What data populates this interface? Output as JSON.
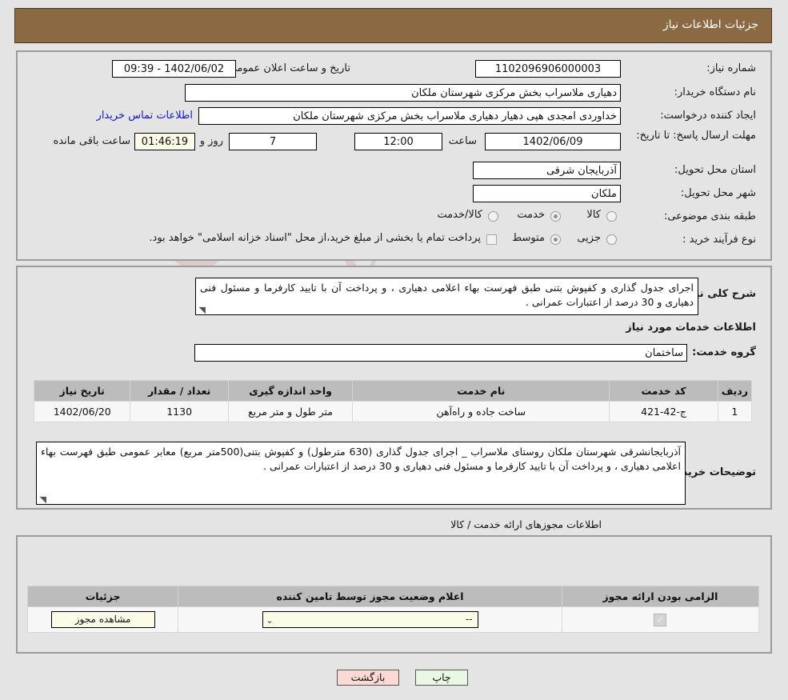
{
  "header": {
    "title": "جزئیات اطلاعات نیاز"
  },
  "top_form": {
    "need_number_label": "شماره نیاز:",
    "need_number_value": "1102096906000003",
    "announce_datetime_label": "تاریخ و ساعت اعلان عمومی:",
    "announce_datetime_value": "1402/06/02 - 09:39",
    "buyer_org_label": "نام دستگاه خریدار:",
    "buyer_org_value": "دهیاری ملاسراب بخش مرکزی شهرستان ملکان",
    "requester_label": "ایجاد کننده درخواست:",
    "requester_value": "خداوردی امجدی هپی دهیار دهیاری ملاسراب بخش مرکزی شهرستان ملکان",
    "contact_link": "اطلاعات تماس خریدار",
    "deadline_label": "مهلت ارسال پاسخ: تا تاریخ:",
    "deadline_date": "1402/06/09",
    "hour_label": "ساعت",
    "hour_value": "12:00",
    "days_value": "7",
    "days_label": "روز و",
    "countdown_value": "01:46:19",
    "remaining_label": "ساعت باقی مانده",
    "province_label": "استان محل تحویل:",
    "province_value": "آذربایجان شرقی",
    "city_label": "شهر محل تحویل:",
    "city_value": "ملکان",
    "classification_label": "طبقه بندی موضوعی:",
    "classification_options": [
      {
        "label": "کالا",
        "selected": false
      },
      {
        "label": "خدمت",
        "selected": true
      },
      {
        "label": "کالا/خدمت",
        "selected": false
      }
    ],
    "process_label": "نوع فرآیند خرید :",
    "process_options": [
      {
        "label": "جزیی",
        "selected": false
      },
      {
        "label": "متوسط",
        "selected": true
      }
    ],
    "treasury_note": "پرداخت تمام یا بخشی از مبلغ خرید،از محل \"اسناد خزانه اسلامی\" خواهد بود."
  },
  "need_summary": {
    "label": "شرح کلی نیاز:",
    "text": "اجرای جدول گذاری و کفپوش بتنی طبق فهرست بهاء اعلامی دهیاری ، و پرداخت آن با تایید کارفرما و مسئول فنی دهیاری و 30 درصد از اعتبارات عمرانی ."
  },
  "services_section": {
    "heading": "اطلاعات خدمات مورد نیاز",
    "service_group_label": "گروه خدمت:",
    "service_group_value": "ساختمان",
    "table": {
      "columns": [
        "ردیف",
        "کد خدمت",
        "نام خدمت",
        "واحد اندازه گیری",
        "تعداد / مقدار",
        "تاریخ نیاز"
      ],
      "rows": [
        {
          "row": "1",
          "code": "ج-42-421",
          "name": "ساخت جاده و راه‌آهن",
          "unit": "متر طول و متر مربع",
          "quantity": "1130",
          "date": "1402/06/20"
        }
      ]
    }
  },
  "buyer_notes": {
    "label": "توضیحات خریدار:",
    "text": "آذربایجانشرقی شهرستان ملکان روستای ملاسراب _ اجرای جدول گذاری (630 مترطول) و کفپوش بتنی(500متر مربع) معابر عمومی طبق فهرست بهاء اعلامی دهیاری ، و پرداخت آن با تایید کارفرما و مسئول فنی دهیاری و 30 درصد از اعتبارات عمرانی ."
  },
  "permits_section": {
    "heading": "اطلاعات مجوزهای ارائه خدمت / کالا",
    "table": {
      "columns": [
        "الزامی بودن ارائه مجوز",
        "اعلام وضعیت مجوز توسط تامین کننده",
        "جزئیات"
      ],
      "rows": [
        {
          "required_checked": true,
          "status_value": "--",
          "details_button": "مشاهده مجوز"
        }
      ]
    }
  },
  "footer": {
    "print_label": "چاپ",
    "back_label": "بازگشت"
  },
  "watermark": {
    "text": "AriaTender.net"
  },
  "colors": {
    "header_bar": "#8b6a43",
    "page_bg": "#e4e4e4",
    "link": "#1414cf",
    "table_header": "#bcbcbc",
    "ivory_field": "#fcfbe8",
    "print_button": "#e9f7e4",
    "back_button": "#fbd9d5"
  }
}
